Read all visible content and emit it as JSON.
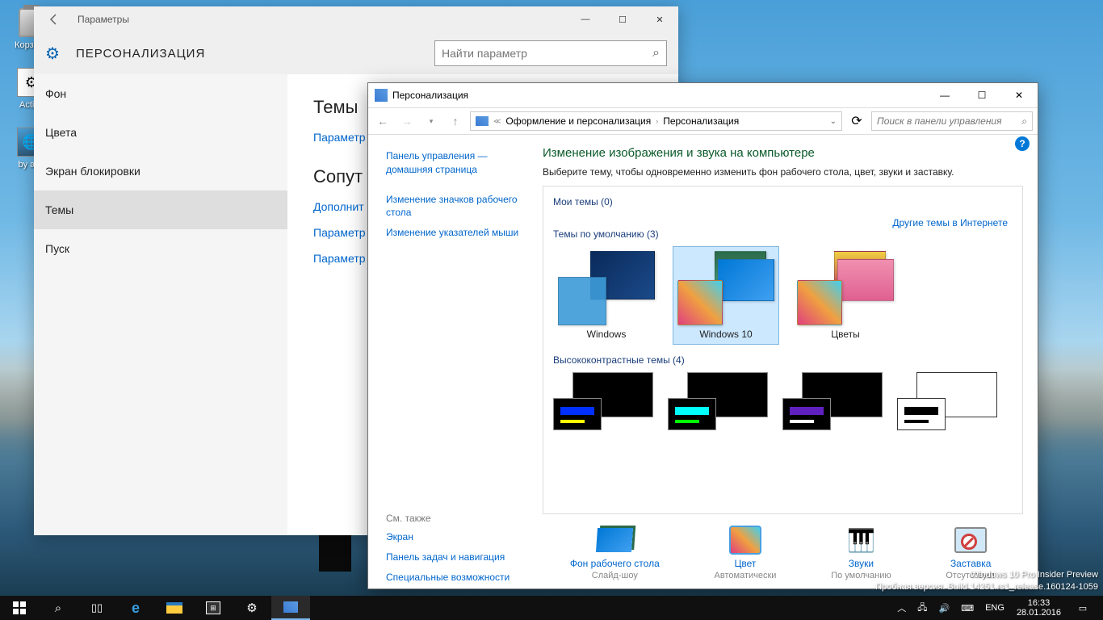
{
  "desktop": {
    "icons": [
      {
        "label": "Корзина"
      },
      {
        "label": "Activa"
      },
      {
        "label": "by adg"
      }
    ]
  },
  "settings_window": {
    "title": "Параметры",
    "header": "ПЕРСОНАЛИЗАЦИЯ",
    "search_placeholder": "Найти параметр",
    "sidebar": [
      "Фон",
      "Цвета",
      "Экран блокировки",
      "Темы",
      "Пуск"
    ],
    "active_index": 3,
    "content": {
      "h_themes": "Темы",
      "link_settings": "Параметр",
      "h_related": "Сопут",
      "link_advanced": "Дополнит",
      "link_param1": "Параметр",
      "link_param2": "Параметр"
    }
  },
  "cp_window": {
    "title": "Персонализация",
    "breadcrumb": {
      "p1": "Оформление и персонализация",
      "p2": "Персонализация"
    },
    "search_placeholder": "Поиск в панели управления",
    "sidebar": {
      "home": "Панель управления — домашняя страница",
      "change_icons": "Изменение значков рабочего стола",
      "change_cursors": "Изменение указателей мыши",
      "see_also": "См. также",
      "screen": "Экран",
      "taskbar": "Панель задач и навигация",
      "accessibility": "Специальные возможности"
    },
    "main": {
      "heading": "Изменение изображения и звука на компьютере",
      "subtext": "Выберите тему, чтобы одновременно изменить фон рабочего стола, цвет, звуки и заставку.",
      "my_themes": "Мои темы (0)",
      "online_link": "Другие темы в Интернете",
      "default_themes": "Темы по умолчанию (3)",
      "themes": [
        "Windows",
        "Windows 10",
        "Цветы"
      ],
      "hc_themes": "Высококонтрастные темы (4)"
    },
    "footer": {
      "bg": {
        "title": "Фон рабочего стола",
        "sub": "Слайд-шоу"
      },
      "color": {
        "title": "Цвет",
        "sub": "Автоматически"
      },
      "sounds": {
        "title": "Звуки",
        "sub": "По умолчанию"
      },
      "saver": {
        "title": "Заставка",
        "sub": "Отсутствует"
      }
    }
  },
  "watermark": {
    "line1": "Windows 10 Pro Insider Preview",
    "line2": "Пробная версия. Build 14251.rs1_release.160124-1059"
  },
  "taskbar": {
    "lang": "ENG",
    "time": "16:33",
    "date": "28.01.2016"
  }
}
